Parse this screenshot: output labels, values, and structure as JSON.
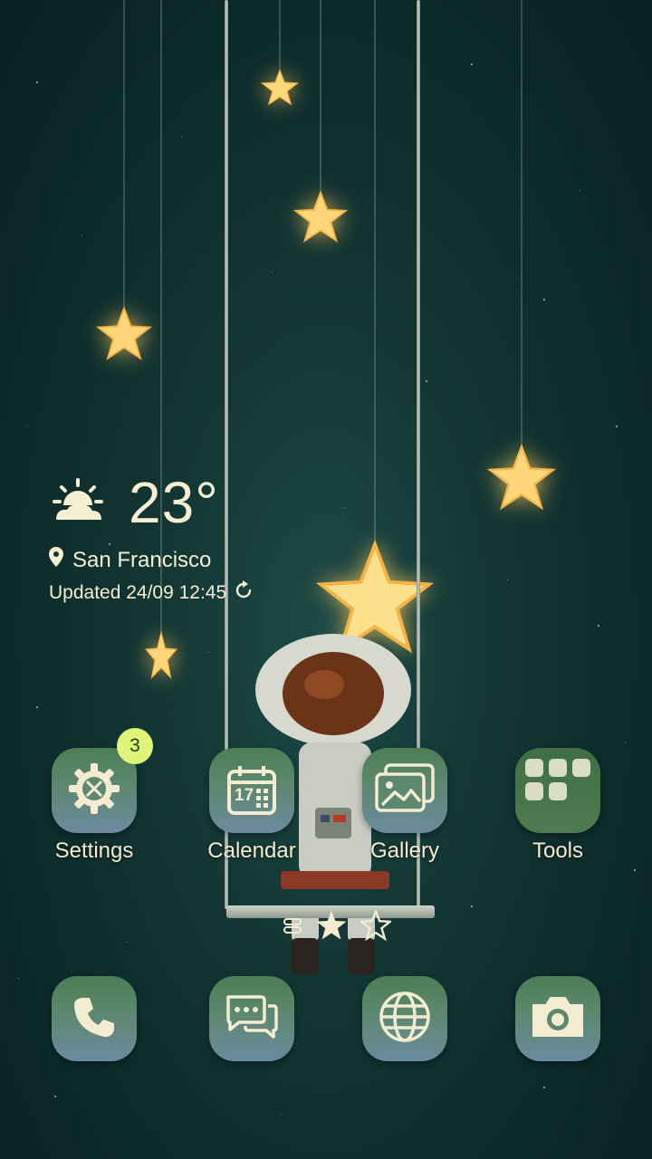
{
  "weather": {
    "temperature": "23°",
    "location": "San Francisco",
    "updated": "Updated 24/09 12:45",
    "icon": "partly-cloudy-icon"
  },
  "apps": [
    {
      "label": "Settings",
      "icon": "settings-icon",
      "badge": "3"
    },
    {
      "label": "Calendar",
      "icon": "calendar-icon",
      "date": "17"
    },
    {
      "label": "Gallery",
      "icon": "gallery-icon"
    },
    {
      "label": "Tools",
      "icon": "folder-icon"
    }
  ],
  "dock": [
    {
      "icon": "phone-icon"
    },
    {
      "icon": "messages-icon"
    },
    {
      "icon": "internet-icon"
    },
    {
      "icon": "camera-icon"
    }
  ],
  "page_indicator": {
    "pages": 3,
    "current_page": 2
  },
  "colors": {
    "accent_text": "#f5eed0",
    "badge": "#dff57a",
    "star_glow": "#ffcf6a"
  }
}
